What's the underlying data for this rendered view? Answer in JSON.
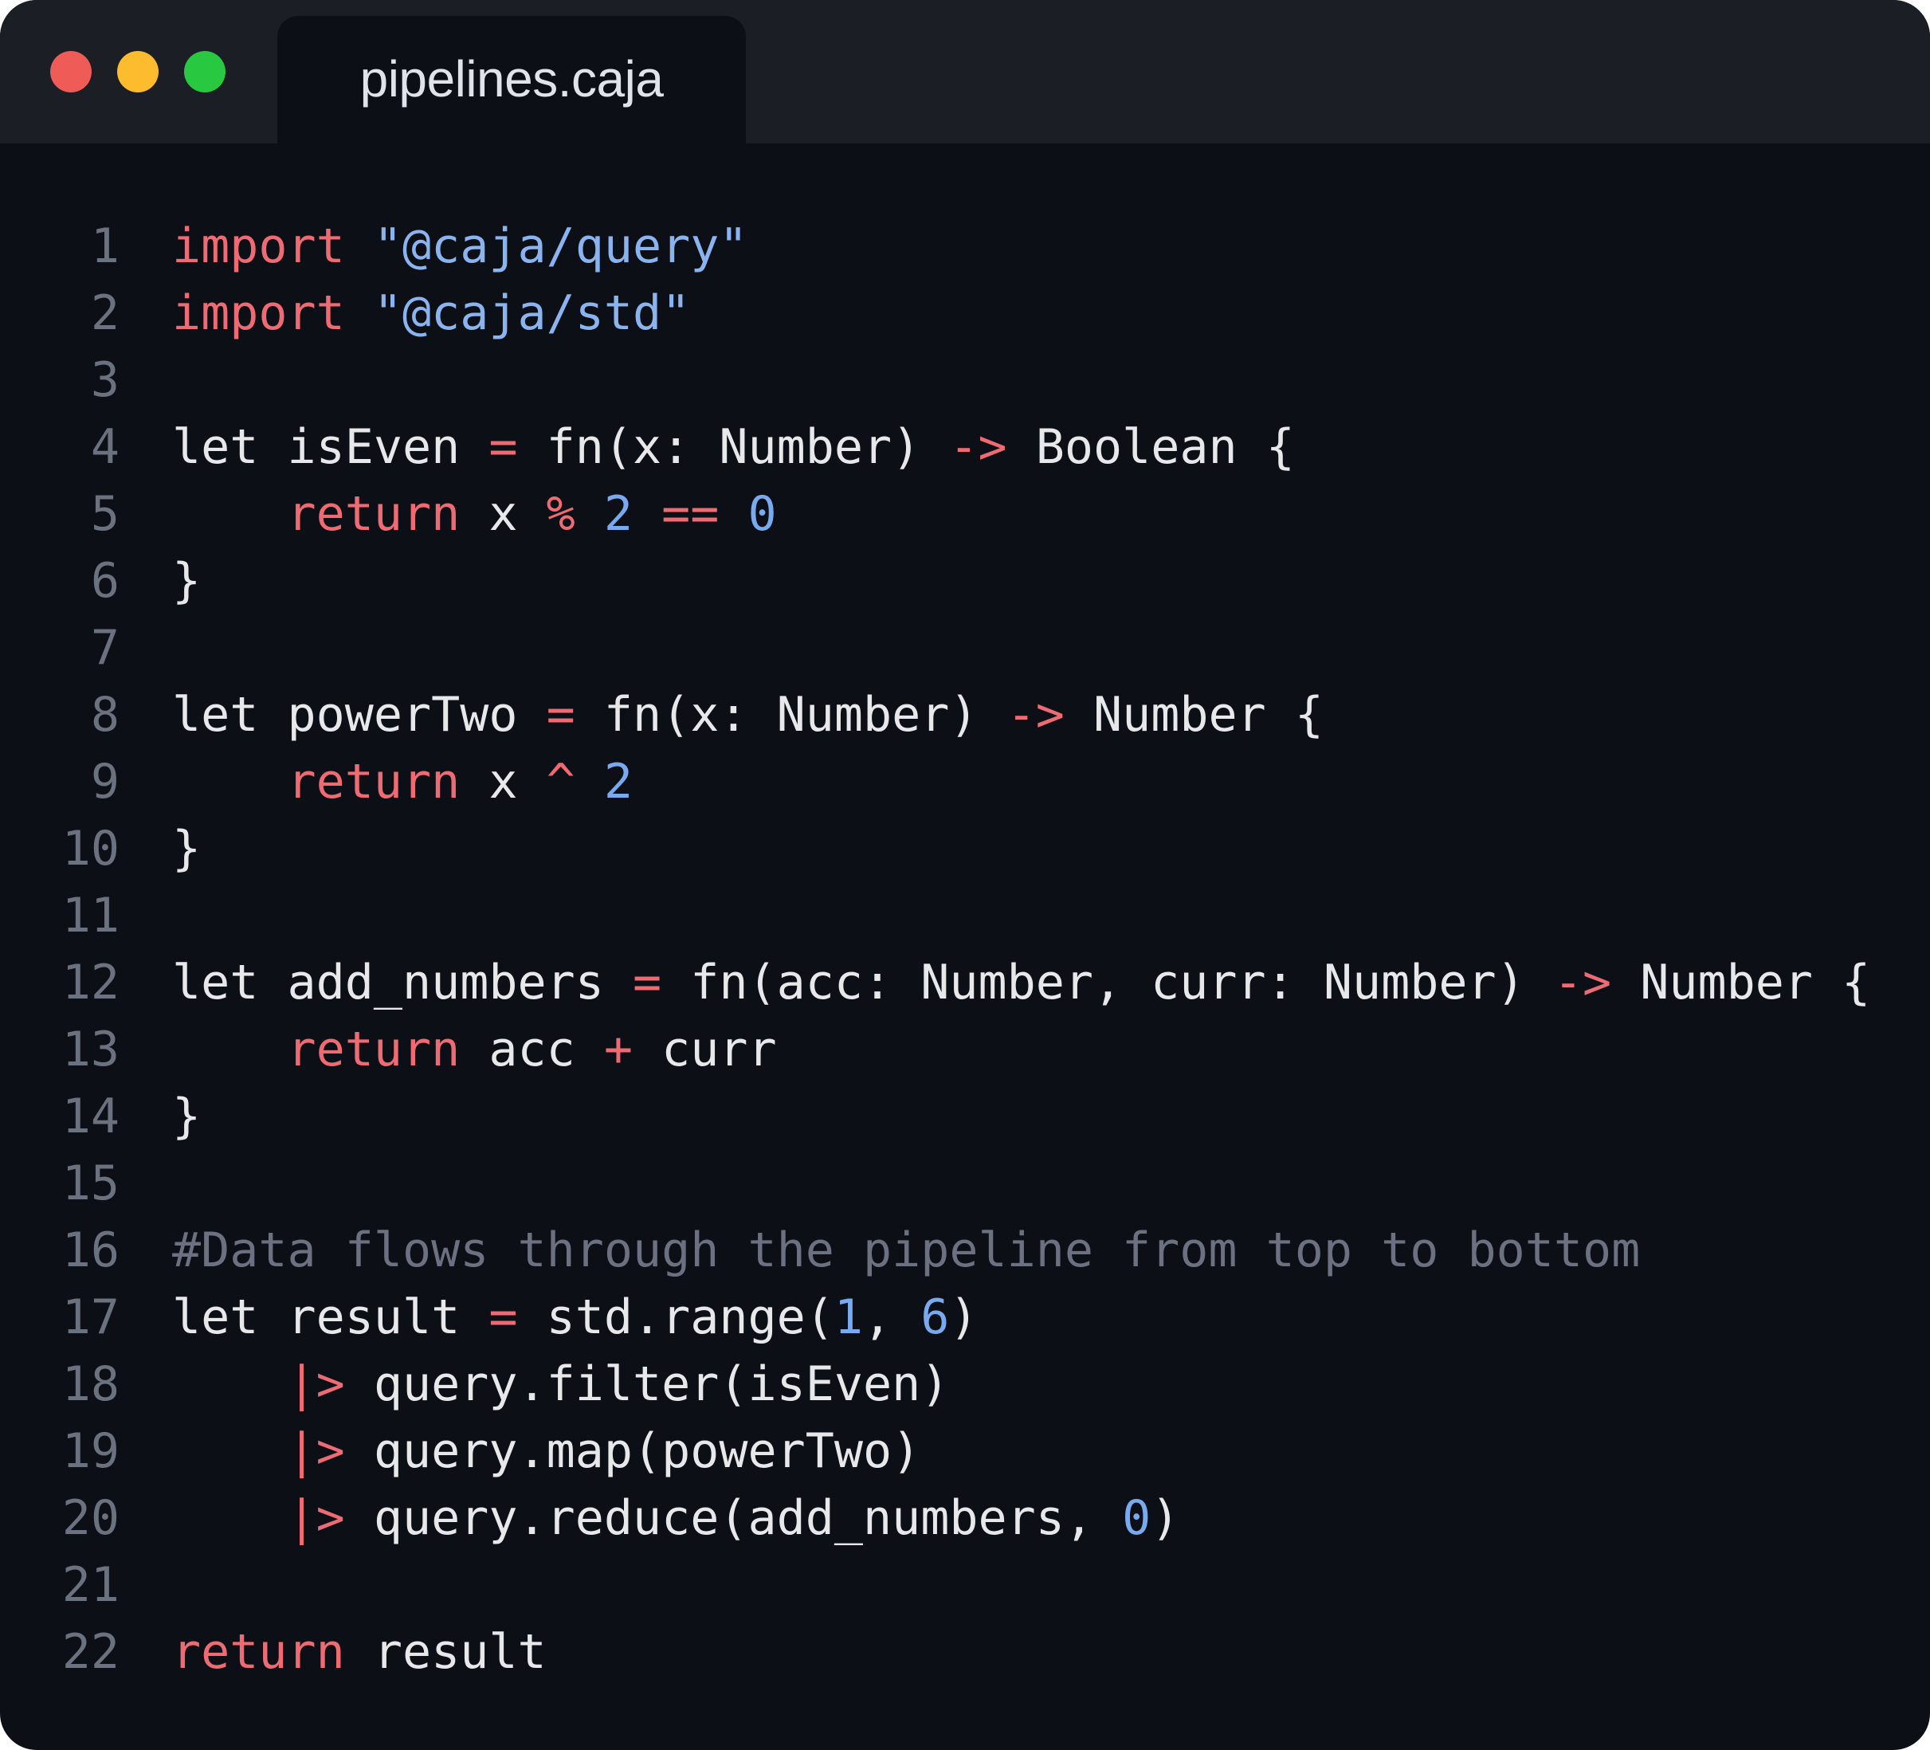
{
  "window": {
    "tab_title": "pipelines.caja",
    "traffic_lights": {
      "close_color": "#ef5b57",
      "minimize_color": "#fdbc2e",
      "maximize_color": "#28c840"
    }
  },
  "editor": {
    "theme": {
      "background": "#0c0f16",
      "keyword": "#ef6b73",
      "string": "#8ab4f0",
      "number": "#78aaf0",
      "comment": "#6b7180",
      "text": "#e8e8ea"
    },
    "lines": [
      {
        "number": "1",
        "tokens": [
          [
            "kw",
            "import"
          ],
          [
            "pl",
            " "
          ],
          [
            "str",
            "\"@caja/query\""
          ]
        ]
      },
      {
        "number": "2",
        "tokens": [
          [
            "kw",
            "import"
          ],
          [
            "pl",
            " "
          ],
          [
            "str",
            "\"@caja/std\""
          ]
        ]
      },
      {
        "number": "3",
        "tokens": []
      },
      {
        "number": "4",
        "tokens": [
          [
            "pl",
            "let isEven "
          ],
          [
            "op",
            "="
          ],
          [
            "pl",
            " fn(x: Number) "
          ],
          [
            "op",
            "->"
          ],
          [
            "pl",
            " Boolean {"
          ]
        ]
      },
      {
        "number": "5",
        "tokens": [
          [
            "pl",
            "    "
          ],
          [
            "kw",
            "return"
          ],
          [
            "pl",
            " x "
          ],
          [
            "op",
            "%"
          ],
          [
            "pl",
            " "
          ],
          [
            "num",
            "2"
          ],
          [
            "pl",
            " "
          ],
          [
            "op",
            "=="
          ],
          [
            "pl",
            " "
          ],
          [
            "num",
            "0"
          ]
        ]
      },
      {
        "number": "6",
        "tokens": [
          [
            "pl",
            "}"
          ]
        ]
      },
      {
        "number": "7",
        "tokens": []
      },
      {
        "number": "8",
        "tokens": [
          [
            "pl",
            "let powerTwo "
          ],
          [
            "op",
            "="
          ],
          [
            "pl",
            " fn(x: Number) "
          ],
          [
            "op",
            "->"
          ],
          [
            "pl",
            " Number {"
          ]
        ]
      },
      {
        "number": "9",
        "tokens": [
          [
            "pl",
            "    "
          ],
          [
            "kw",
            "return"
          ],
          [
            "pl",
            " x "
          ],
          [
            "op",
            "^"
          ],
          [
            "pl",
            " "
          ],
          [
            "num",
            "2"
          ]
        ]
      },
      {
        "number": "10",
        "tokens": [
          [
            "pl",
            "}"
          ]
        ]
      },
      {
        "number": "11",
        "tokens": []
      },
      {
        "number": "12",
        "tokens": [
          [
            "pl",
            "let add_numbers "
          ],
          [
            "op",
            "="
          ],
          [
            "pl",
            " fn(acc: Number, curr: Number) "
          ],
          [
            "op",
            "->"
          ],
          [
            "pl",
            " Number {"
          ]
        ]
      },
      {
        "number": "13",
        "tokens": [
          [
            "pl",
            "    "
          ],
          [
            "kw",
            "return"
          ],
          [
            "pl",
            " acc "
          ],
          [
            "op",
            "+"
          ],
          [
            "pl",
            " curr"
          ]
        ]
      },
      {
        "number": "14",
        "tokens": [
          [
            "pl",
            "}"
          ]
        ]
      },
      {
        "number": "15",
        "tokens": []
      },
      {
        "number": "16",
        "tokens": [
          [
            "cm",
            "#Data flows through the pipeline from top to bottom"
          ]
        ]
      },
      {
        "number": "17",
        "tokens": [
          [
            "pl",
            "let result "
          ],
          [
            "op",
            "="
          ],
          [
            "pl",
            " std.range("
          ],
          [
            "num",
            "1"
          ],
          [
            "pl",
            ", "
          ],
          [
            "num",
            "6"
          ],
          [
            "pl",
            ")"
          ]
        ]
      },
      {
        "number": "18",
        "tokens": [
          [
            "pl",
            "    "
          ],
          [
            "op",
            "|>"
          ],
          [
            "pl",
            " query.filter(isEven)"
          ]
        ]
      },
      {
        "number": "19",
        "tokens": [
          [
            "pl",
            "    "
          ],
          [
            "op",
            "|>"
          ],
          [
            "pl",
            " query.map(powerTwo)"
          ]
        ]
      },
      {
        "number": "20",
        "tokens": [
          [
            "pl",
            "    "
          ],
          [
            "op",
            "|>"
          ],
          [
            "pl",
            " query.reduce(add_numbers, "
          ],
          [
            "num",
            "0"
          ],
          [
            "pl",
            ")"
          ]
        ]
      },
      {
        "number": "21",
        "tokens": []
      },
      {
        "number": "22",
        "tokens": [
          [
            "kw",
            "return"
          ],
          [
            "pl",
            " result"
          ]
        ]
      }
    ]
  }
}
